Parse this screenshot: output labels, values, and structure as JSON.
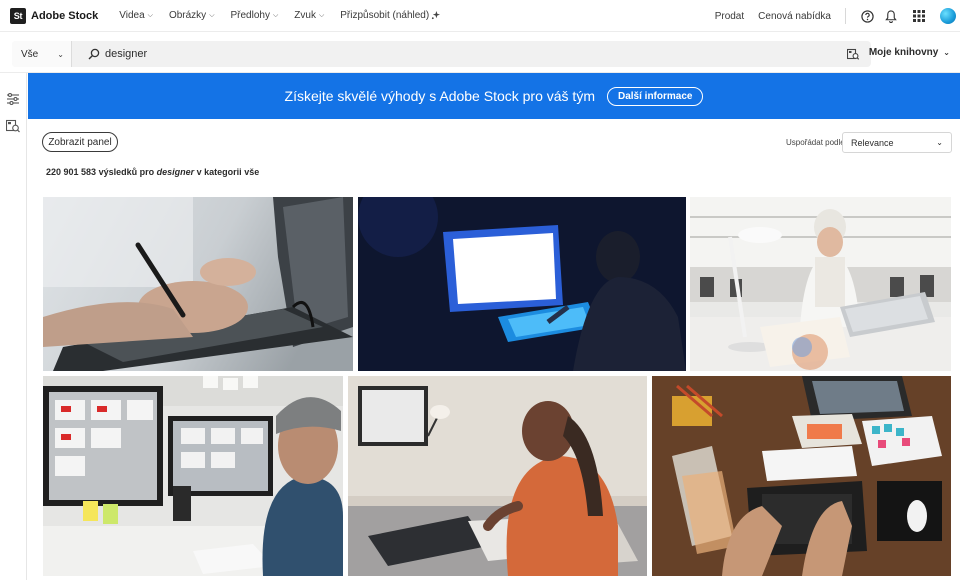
{
  "brand": {
    "logo_mark": "St",
    "name": "Adobe Stock"
  },
  "nav": {
    "items": [
      {
        "label": "Videa"
      },
      {
        "label": "Obrázky"
      },
      {
        "label": "Předlohy"
      },
      {
        "label": "Zvuk"
      },
      {
        "label": "Přizpůsobit (náhled)"
      }
    ],
    "sell": "Prodat",
    "pricing": "Cenová nabídka"
  },
  "search": {
    "scope": "Vše",
    "query": "designer",
    "libraries": "Moje knihovny"
  },
  "banner": {
    "text": "Získejte skvělé výhody s Adobe Stock pro váš tým",
    "button": "Další informace"
  },
  "controls": {
    "show_panel": "Zobrazit panel",
    "sort_label": "Uspořádat podle",
    "sort_value": "Relevance"
  },
  "results": {
    "count": "220 901 583",
    "mid1": "výsledků pro",
    "term": "designer",
    "mid2": "v kategorii",
    "category": "vše"
  },
  "colors": {
    "banner": "#1473e6",
    "text": "#2c2c2c"
  }
}
